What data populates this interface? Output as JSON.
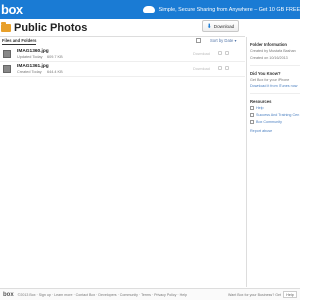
{
  "header": {
    "logo": "box",
    "promo_text": "Simple, Secure Sharing from Anywhere – Get 10 GB FREE",
    "promo_link": "Sign Up"
  },
  "page": {
    "title": "Public Photos",
    "download_label": "Download"
  },
  "toolbar": {
    "tab_label": "Files and Folders",
    "sort_label": "Sort by Date ▾"
  },
  "files": [
    {
      "name": "IMAG1360.jpg",
      "meta": "Updated Today",
      "size": "609.7 KB",
      "action": "Download"
    },
    {
      "name": "IMAG1361.jpg",
      "meta": "Created Today",
      "size": "644.4 KB",
      "action": "Download"
    }
  ],
  "sidebar": {
    "info_heading": "Folder Information",
    "created_by": "Created by Mustafa Bashan",
    "created_on": "Created on 10/16/2013",
    "iphone_heading": "Did You Know?",
    "iphone_text": "Get Box for your iPhone",
    "iphone_link": "Download it from iTunes now",
    "resources_heading": "Resources",
    "resources": [
      "Help",
      "Success And Training Cen",
      "Box Community"
    ],
    "report_link": "Report abuse"
  },
  "footer": {
    "logo": "box",
    "links": "©2013 Box  ·  Sign up  ·  Learn more  ·  Contact Box  ·  Developers  ·  Community  ·  Terms  ·  Privacy Policy  ·  Help",
    "right_text": "Want Box for your Business? Get",
    "help_label": "Help"
  },
  "colors": {
    "brand": "#1a7bd4",
    "folder": "#e8a02b",
    "link": "#4a7fc0"
  }
}
